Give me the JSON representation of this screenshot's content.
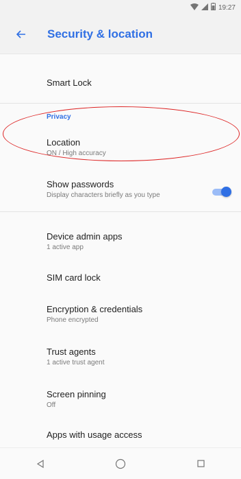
{
  "status_bar": {
    "time": "19:27",
    "icons": [
      "wifi-icon",
      "signal-icon",
      "battery-icon"
    ]
  },
  "app_bar": {
    "title": "Security & location",
    "back_icon": "arrow-back-icon"
  },
  "items": {
    "smart_lock": {
      "title": "Smart Lock"
    },
    "privacy_header": "Privacy",
    "location": {
      "title": "Location",
      "subtitle": "ON / High accuracy"
    },
    "show_passwords": {
      "title": "Show passwords",
      "subtitle": "Display characters briefly as you type",
      "enabled": true
    },
    "device_admin": {
      "title": "Device admin apps",
      "subtitle": "1 active app"
    },
    "sim_lock": {
      "title": "SIM card lock"
    },
    "encryption": {
      "title": "Encryption & credentials",
      "subtitle": "Phone encrypted"
    },
    "trust_agents": {
      "title": "Trust agents",
      "subtitle": "1 active trust agent"
    },
    "screen_pinning": {
      "title": "Screen pinning",
      "subtitle": "Off"
    },
    "usage_access": {
      "title": "Apps with usage access"
    }
  },
  "nav_bar": {
    "buttons": [
      "back-triangle-icon",
      "home-circle-icon",
      "recents-square-icon"
    ]
  },
  "colors": {
    "accent": "#2f6fe4",
    "annotation": "#dd2222"
  }
}
